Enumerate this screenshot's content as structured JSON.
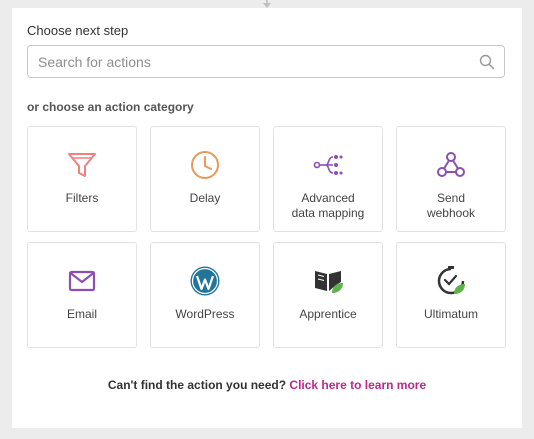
{
  "step": {
    "title": "Choose next step"
  },
  "search": {
    "placeholder": "Search for actions",
    "value": ""
  },
  "category_heading": "or choose an action category",
  "categories": [
    {
      "label": "Filters",
      "icon": "funnel-icon",
      "color": "#f08080"
    },
    {
      "label": "Delay",
      "icon": "clock-icon",
      "color": "#e89a5a"
    },
    {
      "label": "Advanced\ndata mapping",
      "icon": "data-mapping-icon",
      "color": "#8a4fb0"
    },
    {
      "label": "Send\nwebhook",
      "icon": "webhook-icon",
      "color": "#8a4fb0"
    },
    {
      "label": "Email",
      "icon": "envelope-icon",
      "color": "#8a4fb0"
    },
    {
      "label": "WordPress",
      "icon": "wordpress-icon",
      "color": "#21759b"
    },
    {
      "label": "Apprentice",
      "icon": "book-leaf-icon",
      "color": "#333333"
    },
    {
      "label": "Ultimatum",
      "icon": "timer-leaf-icon",
      "color": "#333333"
    }
  ],
  "footer": {
    "question": "Can't find the action you need? ",
    "link_label": "Click here to learn more",
    "link_color": "#c0268f"
  }
}
